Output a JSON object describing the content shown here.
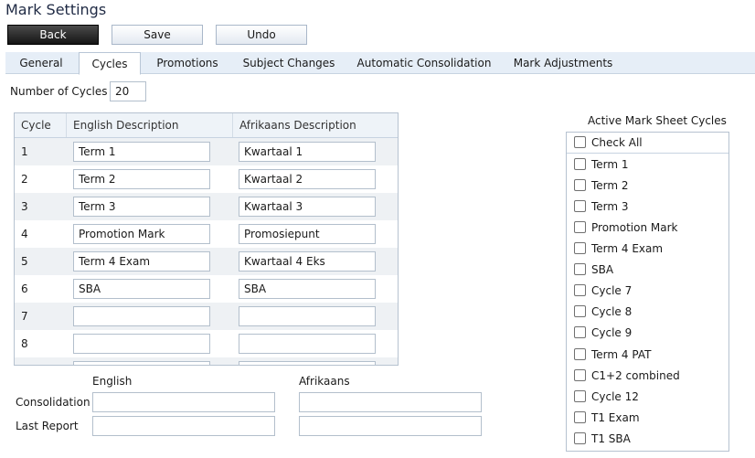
{
  "page": {
    "title": "Mark Settings"
  },
  "toolbar": {
    "back_label": "Back",
    "save_label": "Save",
    "undo_label": "Undo"
  },
  "tabs": [
    {
      "label": "General"
    },
    {
      "label": "Cycles"
    },
    {
      "label": "Promotions"
    },
    {
      "label": "Subject Changes"
    },
    {
      "label": "Automatic Consolidation"
    },
    {
      "label": "Mark Adjustments"
    }
  ],
  "cycles": {
    "count_label": "Number of Cycles",
    "count_value": "20",
    "headers": {
      "cycle": "Cycle",
      "english": "English Description",
      "afrikaans": "Afrikaans Description"
    },
    "rows": [
      {
        "num": "1",
        "en": "Term 1",
        "af": "Kwartaal 1"
      },
      {
        "num": "2",
        "en": "Term 2",
        "af": "Kwartaal 2"
      },
      {
        "num": "3",
        "en": "Term 3",
        "af": "Kwartaal 3"
      },
      {
        "num": "4",
        "en": "Promotion Mark",
        "af": "Promosiepunt"
      },
      {
        "num": "5",
        "en": "Term 4 Exam",
        "af": "Kwartaal 4 Eks"
      },
      {
        "num": "6",
        "en": "SBA",
        "af": "SBA"
      },
      {
        "num": "7",
        "en": "",
        "af": ""
      },
      {
        "num": "8",
        "en": "",
        "af": ""
      },
      {
        "num": "",
        "en": "",
        "af": ""
      }
    ]
  },
  "consolidation": {
    "english_header": "English",
    "afrikaans_header": "Afrikaans",
    "consolidation_label": "Consolidation",
    "last_report_label": "Last Report",
    "consolidation_en": "",
    "consolidation_af": "",
    "last_report_en": "",
    "last_report_af": ""
  },
  "active_cycles": {
    "title": "Active Mark Sheet Cycles",
    "check_all": "Check All",
    "items": [
      "Term 1",
      "Term 2",
      "Term 3",
      "Promotion Mark",
      "Term 4 Exam",
      "SBA",
      "Cycle 7",
      "Cycle 8",
      "Cycle 9",
      "Term 4 PAT",
      "C1+2 combined",
      "Cycle 12",
      "T1 Exam",
      "T1 SBA"
    ]
  }
}
